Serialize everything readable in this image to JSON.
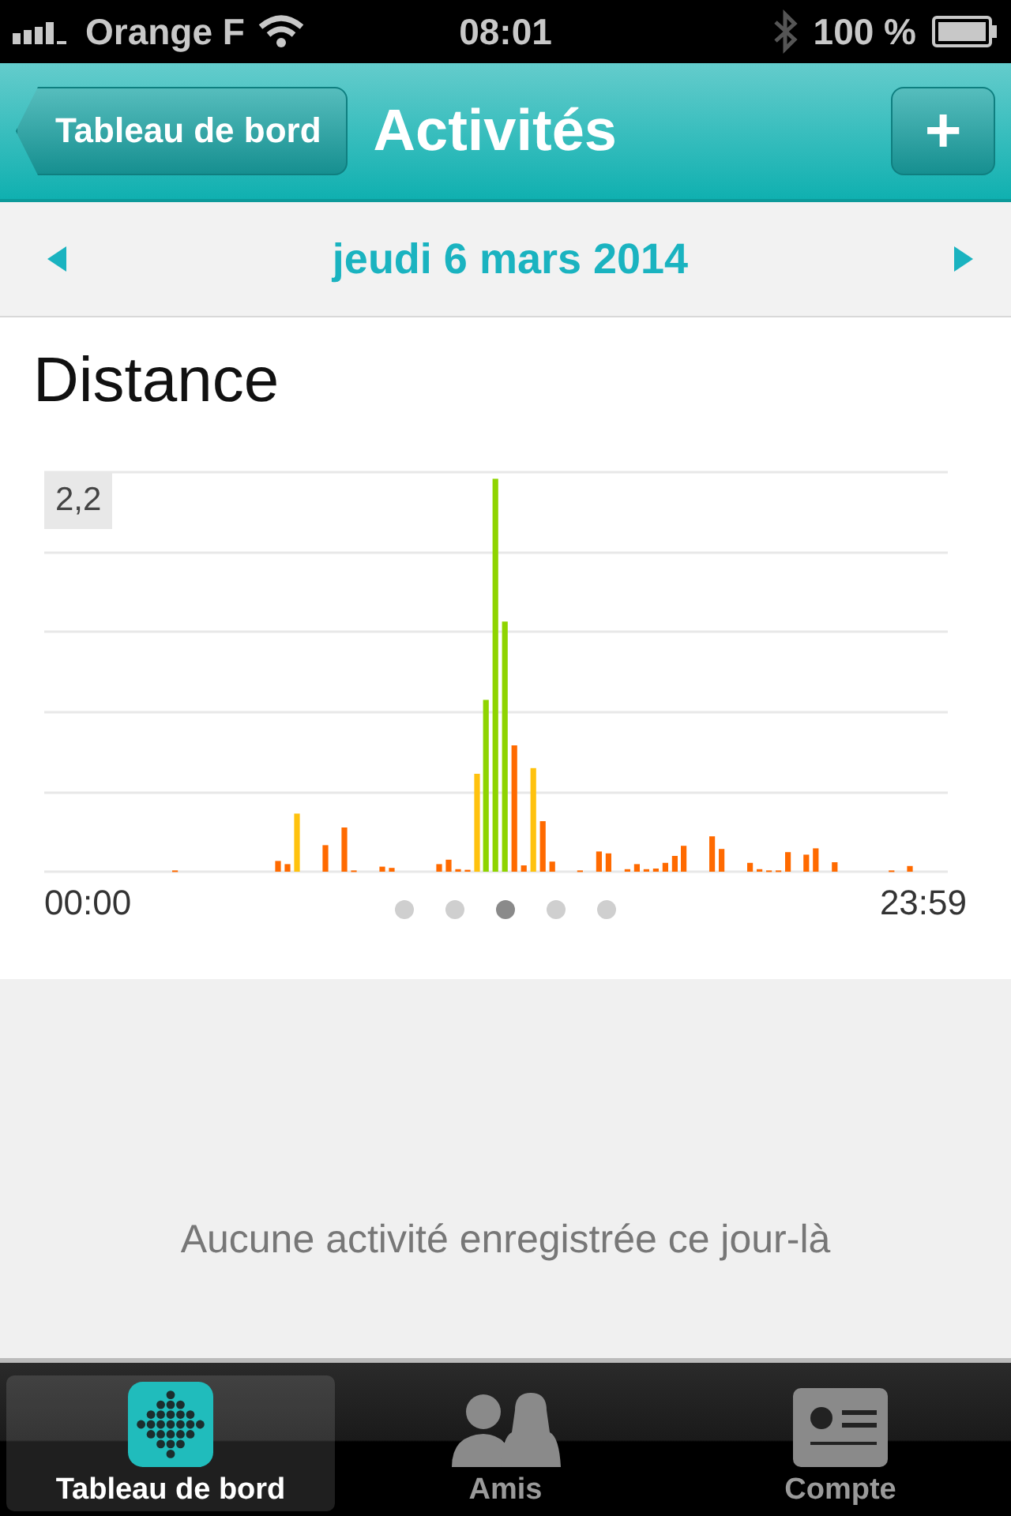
{
  "status_bar": {
    "carrier": "Orange F",
    "time": "08:01",
    "battery": "100 %"
  },
  "nav_bar": {
    "back": "Tableau de bord",
    "title": "Activités",
    "add": "+"
  },
  "date_bar": {
    "date": "jeudi 6 mars 2014"
  },
  "chart_card": {
    "title": "Distance",
    "y_max_label": "2,2",
    "x_start": "00:00",
    "x_end": "23:59"
  },
  "page_dots": [
    {
      "selected": false
    },
    {
      "selected": false
    },
    {
      "selected": true
    },
    {
      "selected": false
    },
    {
      "selected": false
    }
  ],
  "empty_message": "Aucune activité enregistrée ce jour-là",
  "tab_bar": [
    {
      "label": "Tableau de bord",
      "kind": "dashboard",
      "selected": true
    },
    {
      "label": "Amis",
      "kind": "friends",
      "selected": false
    },
    {
      "label": "Compte",
      "kind": "account",
      "selected": false
    }
  ]
}
